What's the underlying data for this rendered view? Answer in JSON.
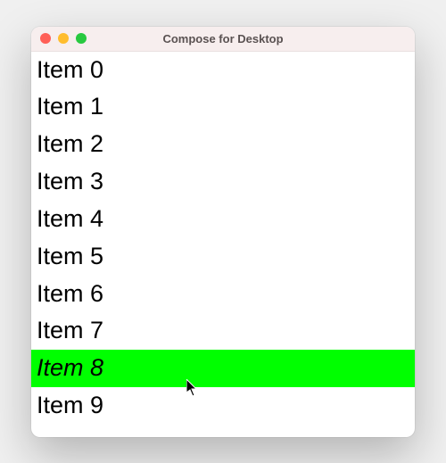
{
  "window": {
    "title": "Compose for Desktop"
  },
  "list": {
    "items": [
      {
        "label": "Item 0",
        "hovered": false
      },
      {
        "label": "Item 1",
        "hovered": false
      },
      {
        "label": "Item 2",
        "hovered": false
      },
      {
        "label": "Item 3",
        "hovered": false
      },
      {
        "label": "Item 4",
        "hovered": false
      },
      {
        "label": "Item 5",
        "hovered": false
      },
      {
        "label": "Item 6",
        "hovered": false
      },
      {
        "label": "Item 7",
        "hovered": false
      },
      {
        "label": "Item 8",
        "hovered": true
      },
      {
        "label": "Item 9",
        "hovered": false
      }
    ]
  },
  "colors": {
    "highlight": "#00ff00"
  }
}
